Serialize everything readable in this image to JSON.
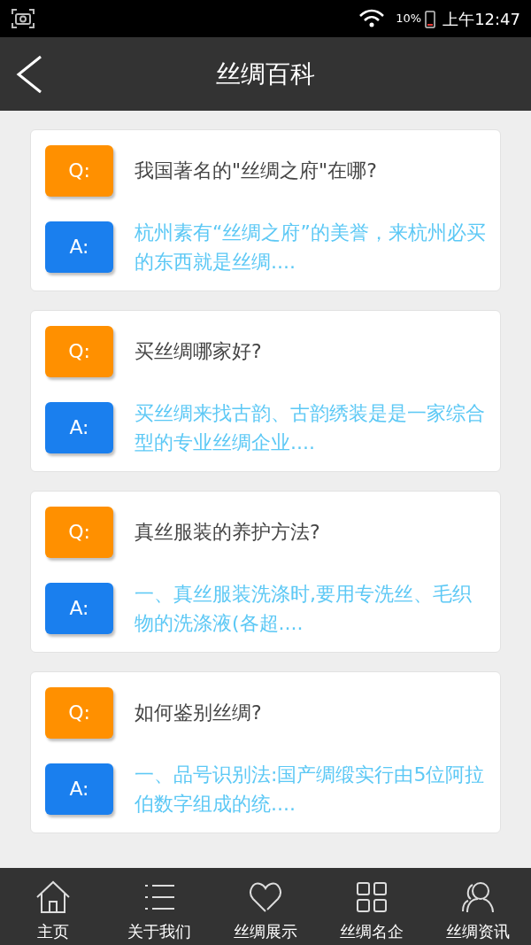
{
  "status_bar": {
    "battery": "10%",
    "time": "上午12:47"
  },
  "header": {
    "title": "丝绸百科"
  },
  "qa_items": [
    {
      "q_label": "Q:",
      "question": "我国著名的\"丝绸之府\"在哪?",
      "a_label": "A:",
      "answer": "杭州素有“丝绸之府”的美誉，来杭州必买的东西就是丝绸...."
    },
    {
      "q_label": "Q:",
      "question": "买丝绸哪家好?",
      "a_label": "A:",
      "answer": "买丝绸来找古韵、古韵绣装是是一家综合型的专业丝绸企业...."
    },
    {
      "q_label": "Q:",
      "question": "真丝服装的养护方法?",
      "a_label": "A:",
      "answer": "一、真丝服装洗涤时,要用专洗丝、毛织物的洗涤液(各超...."
    },
    {
      "q_label": "Q:",
      "question": "如何鉴别丝绸?",
      "a_label": "A:",
      "answer": "一、品号识别法:国产绸缎实行由5位阿拉伯数字组成的统...."
    }
  ],
  "bottom_nav": [
    {
      "kind": "home",
      "label": "主页"
    },
    {
      "kind": "list",
      "label": "关于我们"
    },
    {
      "kind": "heart",
      "label": "丝绸展示"
    },
    {
      "kind": "grid",
      "label": "丝绸名企"
    },
    {
      "kind": "people",
      "label": "丝绸资讯"
    }
  ]
}
